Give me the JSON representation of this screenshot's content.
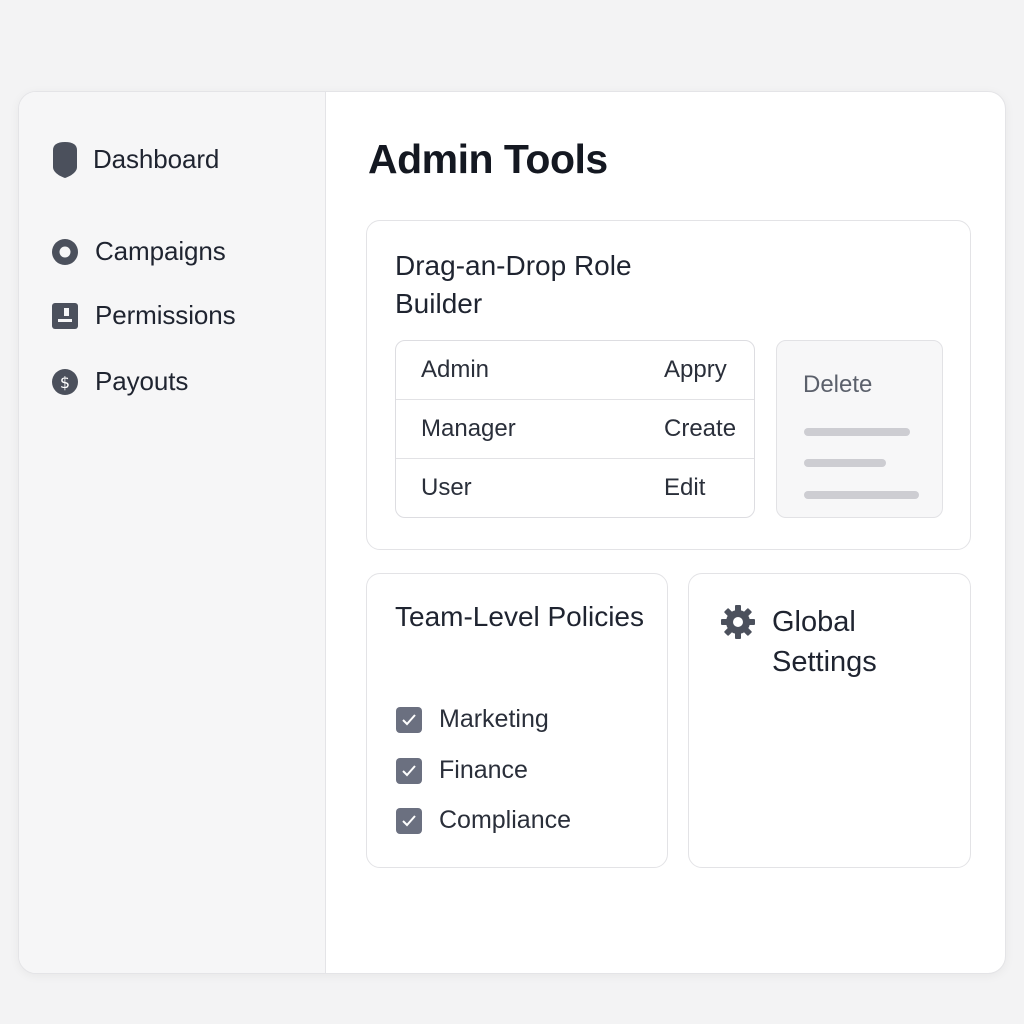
{
  "sidebar": {
    "items": [
      {
        "label": "Dashboard",
        "icon": "shield-icon"
      },
      {
        "label": "Campaigns",
        "icon": "circle-icon"
      },
      {
        "label": "Permissions",
        "icon": "permissions-icon"
      },
      {
        "label": "Payouts",
        "icon": "dollar-icon"
      }
    ]
  },
  "main": {
    "title": "Admin Tools",
    "role_builder": {
      "title": "Drag-an-Drop Role Builder",
      "rows": [
        {
          "role": "Admin",
          "permission": "Appry"
        },
        {
          "role": "Manager",
          "permission": "Create"
        },
        {
          "role": "User",
          "permission": "Edit"
        }
      ],
      "delete_zone_label": "Delete"
    },
    "policies": {
      "title": "Team-Level Policies",
      "items": [
        {
          "label": "Marketing",
          "checked": true
        },
        {
          "label": "Finance",
          "checked": true
        },
        {
          "label": "Compliance",
          "checked": true
        }
      ]
    },
    "global_settings": {
      "title": "Global Settings",
      "icon": "gear-icon"
    }
  },
  "colors": {
    "icon": "#4b505c",
    "checkbox": "#6b7080",
    "sidebar_bg": "#f6f6f7",
    "text": "#1f2430"
  }
}
